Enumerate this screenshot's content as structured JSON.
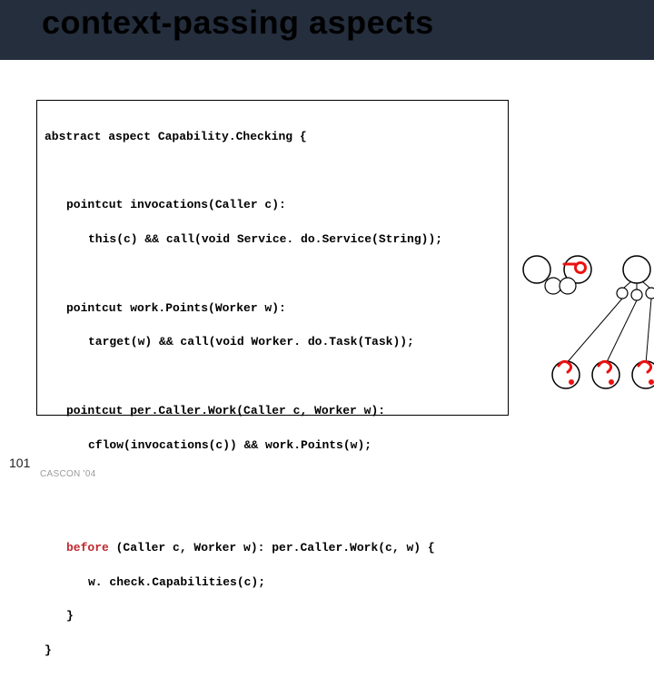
{
  "title": "context-passing aspects",
  "code": {
    "l1": "abstract aspect Capability.Checking {",
    "l2": "pointcut invocations(Caller c):",
    "l3": "this(c) && call(void Service. do.Service(String));",
    "l4": "pointcut work.Points(Worker w):",
    "l5": "target(w) && call(void Worker. do.Task(Task));",
    "l6": "pointcut per.Caller.Work(Caller c, Worker w):",
    "l7": "cflow(invocations(c)) && work.Points(w);",
    "l8a": "before",
    "l8b": " (Caller c, Worker w): per.Caller.Work(c, w) {",
    "l9": "w. check.Capabilities(c);",
    "l10": "}",
    "l11": "}"
  },
  "footer": {
    "slide_number": "101",
    "event": "CASCON '04"
  }
}
